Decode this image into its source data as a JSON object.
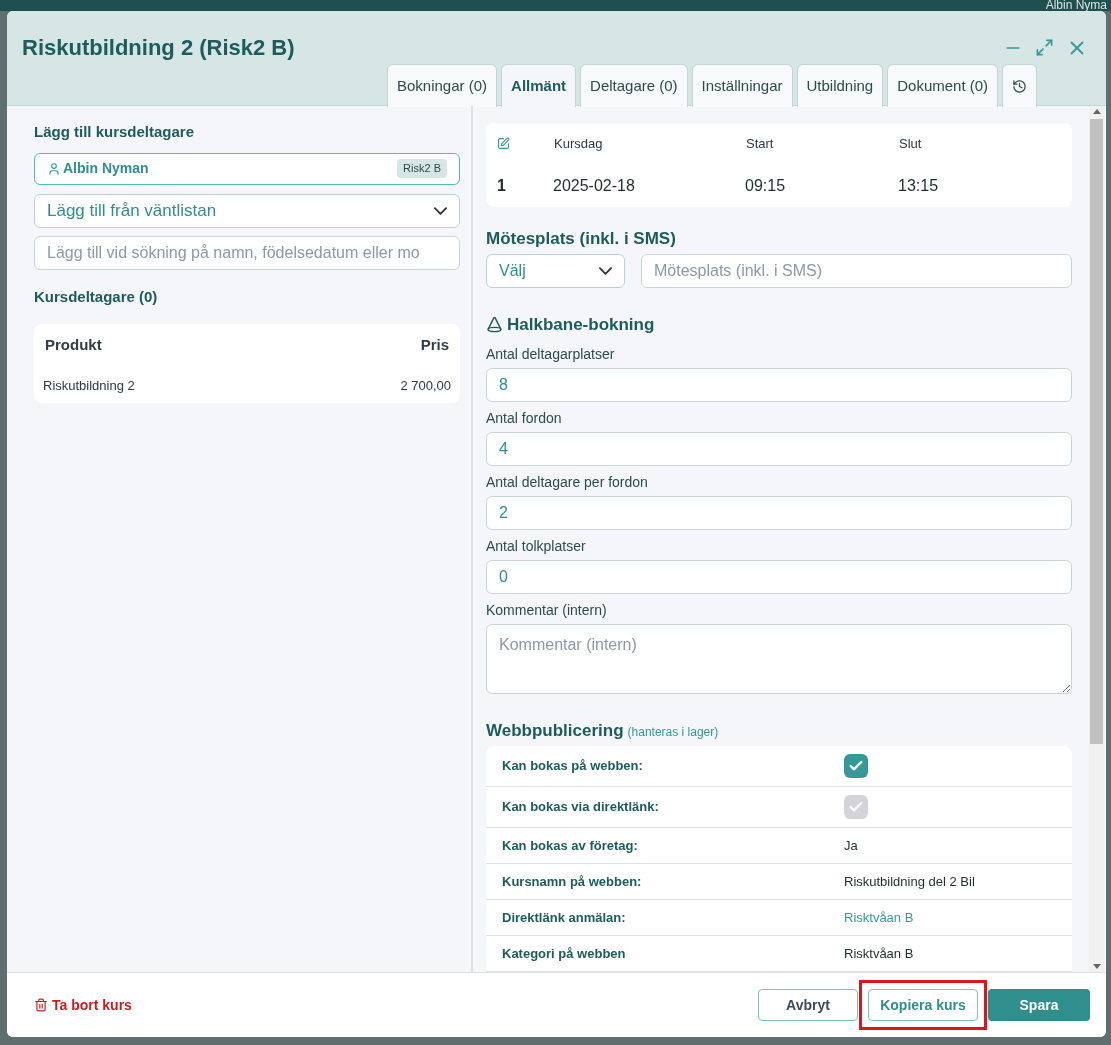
{
  "background": {
    "user_name": "Albin Nyma"
  },
  "window": {
    "title": "Riskutbildning 2 (Risk2 B)"
  },
  "tabs": [
    {
      "label": "Bokningar (0)",
      "selected": false
    },
    {
      "label": "Allmänt",
      "selected": true
    },
    {
      "label": "Deltagare (0)",
      "selected": false
    },
    {
      "label": "Inställningar",
      "selected": false
    },
    {
      "label": "Utbildning",
      "selected": false
    },
    {
      "label": "Dokument (0)",
      "selected": false
    }
  ],
  "add_participant": {
    "heading": "Lägg till kursdeltagare",
    "selected_person": {
      "name": "Albin Nyman",
      "tag": "Risk2 B"
    },
    "waitlist_select": {
      "value": "Lägg till från väntlistan"
    },
    "search": {
      "placeholder": "Lägg till vid sökning på namn, födelsedatum eller mo"
    }
  },
  "participants": {
    "heading": "Kursdeltagare (0)",
    "columns": [
      "Produkt",
      "Pris"
    ],
    "rows": [
      [
        "Riskutbildning 2",
        "2 700,00"
      ]
    ]
  },
  "course_days": {
    "columns": [
      "Kursdag",
      "Start",
      "Slut"
    ],
    "rows": [
      {
        "number": "1",
        "date": "2025-02-18",
        "start": "09:15",
        "end": "13:15"
      }
    ]
  },
  "meeting_place": {
    "heading": "Mötesplats (inkl. i SMS)",
    "select": {
      "value": "Välj"
    },
    "input": {
      "placeholder": "Mötesplats (inkl. i SMS)"
    }
  },
  "slippery_track": {
    "heading": "Halkbane-bokning",
    "fields": [
      {
        "label": "Antal deltagarplatser",
        "value": "8"
      },
      {
        "label": "Antal fordon",
        "value": "4"
      },
      {
        "label": "Antal deltagare per fordon",
        "value": "2"
      },
      {
        "label": "Antal tolkplatser",
        "value": "0"
      }
    ],
    "comment": {
      "label": "Kommentar (intern)",
      "placeholder": "Kommentar (intern)"
    }
  },
  "web_publishing": {
    "heading": "Webbpublicering",
    "note": "(hanteras i lager)",
    "rows": [
      {
        "label": "Kan bokas på webben:",
        "kind": "checkbox",
        "checked": true,
        "disabled": false
      },
      {
        "label": "Kan bokas via direktlänk:",
        "kind": "checkbox",
        "checked": true,
        "disabled": true
      },
      {
        "label": "Kan bokas av företag:",
        "kind": "text",
        "value": "Ja"
      },
      {
        "label": "Kursnamn på webben:",
        "kind": "text",
        "value": "Riskutbildning del 2 Bil"
      },
      {
        "label": "Direktlänk anmälan:",
        "kind": "link",
        "value": "Risktvåan B"
      },
      {
        "label": "Kategori på webben",
        "kind": "text",
        "value": "Risktvåan B"
      }
    ]
  },
  "footer": {
    "delete": "Ta bort kurs",
    "buttons": [
      {
        "label": "Avbryt",
        "kind": "outline",
        "highlighted": false
      },
      {
        "label": "Kopiera kurs",
        "kind": "secondary",
        "highlighted": true
      },
      {
        "label": "Spara",
        "kind": "primary",
        "highlighted": false
      }
    ]
  }
}
